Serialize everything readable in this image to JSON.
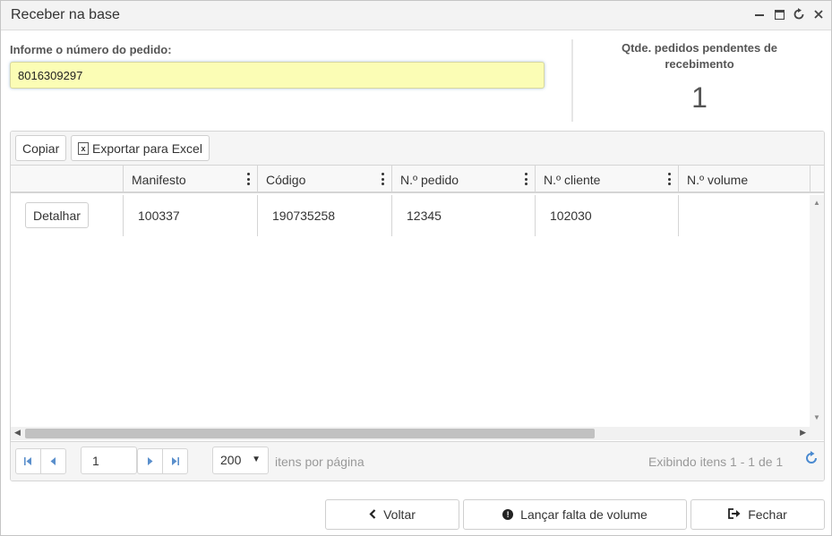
{
  "window": {
    "title": "Receber na base",
    "controls": [
      "minimize-icon",
      "maximize-icon",
      "refresh-icon",
      "close-icon"
    ]
  },
  "form": {
    "order_label": "Informe o número do pedido:",
    "order_value": "8016309297"
  },
  "pending": {
    "label": "Qtde. pedidos pendentes de recebimento",
    "count": "1"
  },
  "toolbar": {
    "copy_label": "Copiar",
    "export_label": "Exportar para Excel"
  },
  "table": {
    "columns": [
      "",
      "Manifesto",
      "Código",
      "N.º pedido",
      "N.º cliente",
      "N.º volume"
    ],
    "rows": [
      {
        "action": "Detalhar",
        "manifesto": "100337",
        "codigo": "190735258",
        "pedido": "12345",
        "cliente": "102030",
        "volume": ""
      }
    ]
  },
  "pager": {
    "page": "1",
    "page_size": "200",
    "per_page_label": "itens por página",
    "info": "Exibindo itens 1 - 1 de 1"
  },
  "footer": {
    "back_label": "Voltar",
    "missing_label": "Lançar falta de volume",
    "close_label": "Fechar"
  }
}
